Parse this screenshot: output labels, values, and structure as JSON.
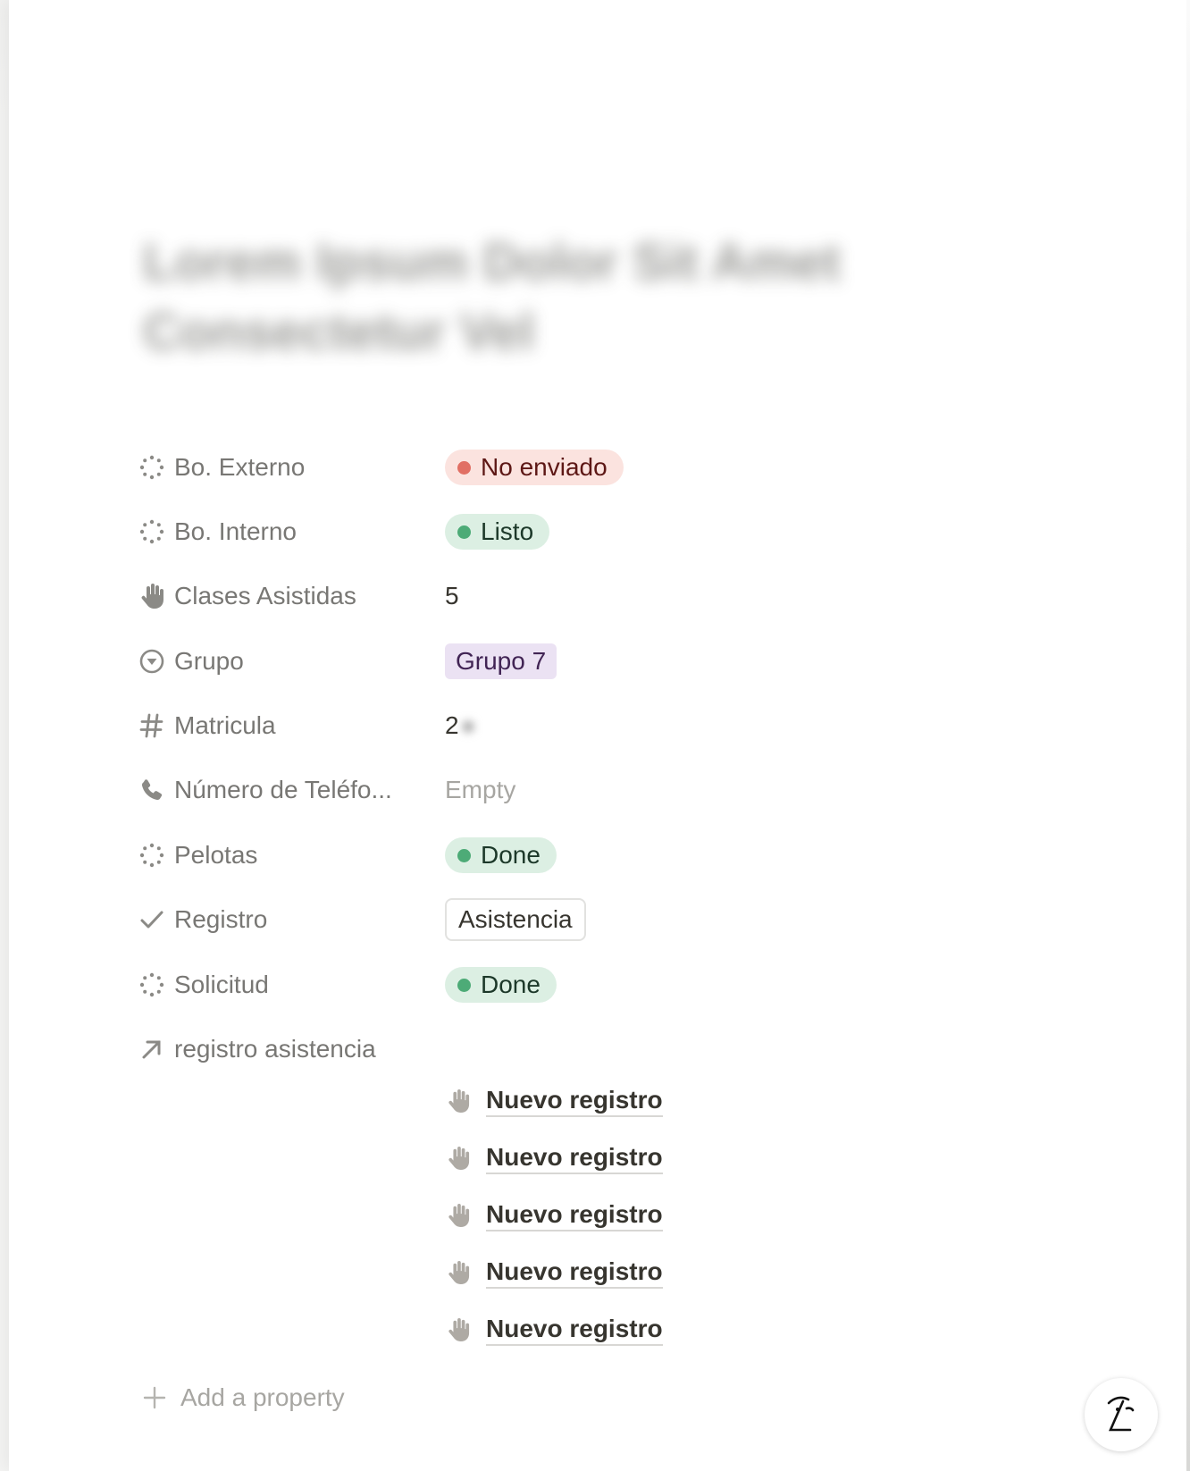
{
  "page": {
    "title": "Lorem Ipsum Dolor Sit Amet Consectetur Vel"
  },
  "properties": [
    {
      "label": "Bo. Externo",
      "icon": "status-icon",
      "value": "No enviado",
      "type": "status",
      "color": "#e16f64",
      "bg": "#fbe3df",
      "text_color": "#5d1715"
    },
    {
      "label": "Bo. Interno",
      "icon": "status-icon",
      "value": "Listo",
      "type": "status",
      "color": "#4dab77",
      "bg": "#dcefe3",
      "text_color": "#1c3829"
    },
    {
      "label": "Clases Asistidas",
      "icon": "hand-icon",
      "value": "5",
      "type": "number"
    },
    {
      "label": "Grupo",
      "icon": "select-icon",
      "value": "Grupo 7",
      "type": "select",
      "bg": "#ebe2f3",
      "text_color": "#412454"
    },
    {
      "label": "Matricula",
      "icon": "hash-icon",
      "value": "2",
      "type": "number"
    },
    {
      "label": "Número de Teléfo...",
      "icon": "phone-icon",
      "value": "Empty",
      "type": "empty"
    },
    {
      "label": "Pelotas",
      "icon": "status-icon",
      "value": "Done",
      "type": "status",
      "color": "#4dab77",
      "bg": "#dcefe3",
      "text_color": "#1c3829"
    },
    {
      "label": "Registro",
      "icon": "check-icon",
      "value": "Asistencia",
      "type": "button"
    },
    {
      "label": "Solicitud",
      "icon": "status-icon",
      "value": "Done",
      "type": "status",
      "color": "#4dab77",
      "bg": "#dcefe3",
      "text_color": "#1c3829"
    },
    {
      "label": "registro asistencia",
      "icon": "relation-arrow-icon",
      "type": "relation"
    }
  ],
  "relations": [
    {
      "label": "Nuevo registro",
      "icon": "hand-icon"
    },
    {
      "label": "Nuevo registro",
      "icon": "hand-icon"
    },
    {
      "label": "Nuevo registro",
      "icon": "hand-icon"
    },
    {
      "label": "Nuevo registro",
      "icon": "hand-icon"
    },
    {
      "label": "Nuevo registro",
      "icon": "hand-icon"
    }
  ],
  "add_property": {
    "label": "Add a property",
    "icon": "plus-icon"
  },
  "help_button": {
    "icon": "help-face-icon"
  }
}
